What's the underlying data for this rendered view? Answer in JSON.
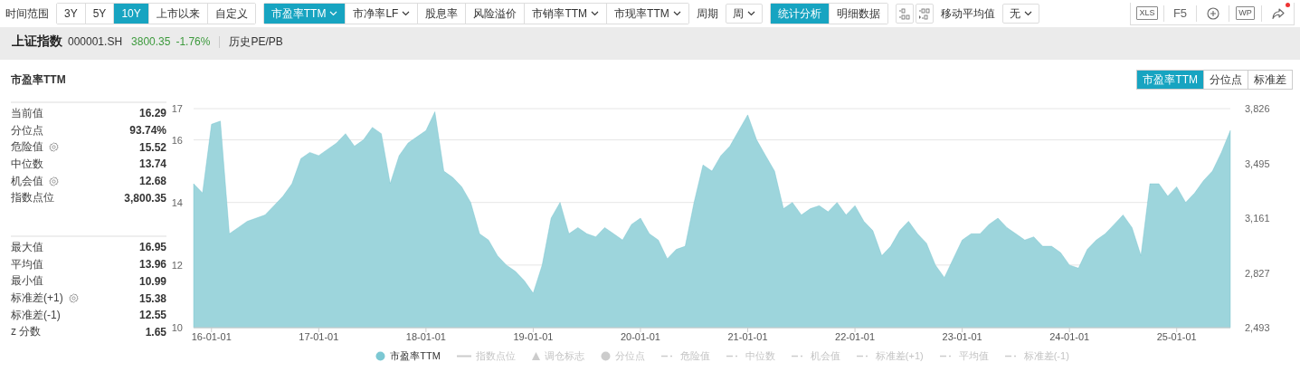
{
  "toolbar": {
    "range_label": "时间范围",
    "ranges": [
      {
        "label": "3Y",
        "selected": false
      },
      {
        "label": "5Y",
        "selected": false
      },
      {
        "label": "10Y",
        "selected": true
      },
      {
        "label": "上市以来",
        "selected": false
      },
      {
        "label": "自定义",
        "selected": false
      }
    ],
    "metrics": [
      {
        "label": "市盈率TTM",
        "dropdown": true,
        "selected": true
      },
      {
        "label": "市净率LF",
        "dropdown": true,
        "selected": false
      },
      {
        "label": "股息率",
        "dropdown": false,
        "selected": false
      },
      {
        "label": "风险溢价",
        "dropdown": false,
        "selected": false
      },
      {
        "label": "市销率TTM",
        "dropdown": true,
        "selected": false
      },
      {
        "label": "市现率TTM",
        "dropdown": true,
        "selected": false
      }
    ],
    "period_label": "周期",
    "period_value": "周",
    "views": [
      {
        "label": "统计分析",
        "selected": true
      },
      {
        "label": "明细数据",
        "selected": false
      }
    ],
    "ma_label": "移动平均值",
    "ma_value": "无",
    "tools": [
      {
        "kind": "file",
        "label": "XLS",
        "badge": false
      },
      {
        "kind": "text",
        "label": "F5",
        "badge": false
      },
      {
        "kind": "plus",
        "badge": false
      },
      {
        "kind": "file",
        "label": "WP",
        "badge": false
      },
      {
        "kind": "share",
        "badge": true
      }
    ]
  },
  "header": {
    "name": "上证指数",
    "code": "000001.SH",
    "price": "3800.35",
    "change": "-1.76%",
    "down": true,
    "subtitle": "历史PE/PB"
  },
  "card": {
    "title": "市盈率TTM",
    "tabs": [
      {
        "label": "市盈率TTM",
        "selected": true
      },
      {
        "label": "分位点",
        "selected": false
      },
      {
        "label": "标准差",
        "selected": false
      }
    ],
    "stats_groups": [
      [
        {
          "label": "当前值",
          "value": "16.29",
          "settings": false
        },
        {
          "label": "分位点",
          "value": "93.74%",
          "settings": false
        },
        {
          "label": "危险值",
          "value": "15.52",
          "settings": true
        },
        {
          "label": "中位数",
          "value": "13.74",
          "settings": false
        },
        {
          "label": "机会值",
          "value": "12.68",
          "settings": true
        },
        {
          "label": "指数点位",
          "value": "3,800.35",
          "settings": false
        }
      ],
      [
        {
          "label": "最大值",
          "value": "16.95",
          "settings": false
        },
        {
          "label": "平均值",
          "value": "13.96",
          "settings": false
        },
        {
          "label": "最小值",
          "value": "10.99",
          "settings": false
        },
        {
          "label": "标准差(+1)",
          "value": "15.38",
          "settings": true
        },
        {
          "label": "标准差(-1)",
          "value": "12.55",
          "settings": false
        },
        {
          "label": "z 分数",
          "value": "1.65",
          "settings": false
        }
      ]
    ],
    "right_axis_labels": [
      "3,826",
      "3,495",
      "3,161",
      "2,827",
      "2,493"
    ],
    "chart_data": {
      "type": "area",
      "grid": true,
      "ylim": [
        10,
        17
      ],
      "yticks": [
        10,
        12,
        14,
        16,
        17
      ],
      "categories": [
        null,
        null,
        "16-01-01",
        null,
        null,
        null,
        null,
        null,
        null,
        null,
        null,
        null,
        null,
        null,
        "17-01-01",
        null,
        null,
        null,
        null,
        null,
        null,
        null,
        null,
        null,
        null,
        null,
        "18-01-01",
        null,
        null,
        null,
        null,
        null,
        null,
        null,
        null,
        null,
        null,
        null,
        "19-01-01",
        null,
        null,
        null,
        null,
        null,
        null,
        null,
        null,
        null,
        null,
        null,
        "20-01-01",
        null,
        null,
        null,
        null,
        null,
        null,
        null,
        null,
        null,
        null,
        null,
        "21-01-01",
        null,
        null,
        null,
        null,
        null,
        null,
        null,
        null,
        null,
        null,
        null,
        "22-01-01",
        null,
        null,
        null,
        null,
        null,
        null,
        null,
        null,
        null,
        null,
        null,
        "23-01-01",
        null,
        null,
        null,
        null,
        null,
        null,
        null,
        null,
        null,
        null,
        null,
        "24-01-01",
        null,
        null,
        null,
        null,
        null,
        null,
        null,
        null,
        null,
        null,
        null,
        "25-01-01",
        null,
        null,
        null,
        null,
        null,
        null
      ],
      "series": [
        {
          "name": "市盈率TTM",
          "color": "#9dd5dc",
          "values": [
            14.6,
            14.3,
            16.5,
            16.6,
            13.0,
            13.2,
            13.4,
            13.5,
            13.6,
            13.9,
            14.2,
            14.6,
            15.4,
            15.6,
            15.5,
            15.7,
            15.9,
            16.2,
            15.8,
            16.0,
            16.4,
            16.2,
            14.6,
            15.5,
            15.9,
            16.1,
            16.3,
            16.9,
            15.0,
            14.8,
            14.5,
            14.0,
            13.0,
            12.8,
            12.3,
            12.0,
            11.8,
            11.5,
            11.1,
            12.0,
            13.5,
            14.0,
            13.0,
            13.2,
            13.0,
            12.9,
            13.2,
            13.0,
            12.8,
            13.3,
            13.5,
            13.0,
            12.8,
            12.2,
            12.5,
            12.6,
            14.0,
            15.2,
            15.0,
            15.5,
            15.8,
            16.3,
            16.8,
            16.0,
            15.5,
            15.0,
            13.8,
            14.0,
            13.6,
            13.8,
            13.9,
            13.7,
            14.0,
            13.6,
            13.9,
            13.4,
            13.1,
            12.3,
            12.6,
            13.1,
            13.4,
            13.0,
            12.7,
            12.0,
            11.6,
            12.2,
            12.8,
            13.0,
            13.0,
            13.3,
            13.5,
            13.2,
            13.0,
            12.8,
            12.9,
            12.6,
            12.6,
            12.4,
            12.0,
            11.9,
            12.5,
            12.8,
            13.0,
            13.3,
            13.6,
            13.2,
            12.3,
            14.6,
            14.6,
            14.2,
            14.5,
            14.0,
            14.3,
            14.7,
            15.0,
            15.6,
            16.3
          ]
        }
      ]
    },
    "legend": [
      {
        "kind": "series",
        "disabled": false
      },
      {
        "kind": "line",
        "label": "指数点位",
        "disabled": true
      },
      {
        "kind": "triangle",
        "label": "调仓标志",
        "disabled": true
      },
      {
        "kind": "dot",
        "label": "分位点",
        "disabled": true
      },
      {
        "kind": "dash",
        "label": "危险值",
        "disabled": true
      },
      {
        "kind": "dash",
        "label": "中位数",
        "disabled": true
      },
      {
        "kind": "dash",
        "label": "机会值",
        "disabled": true
      },
      {
        "kind": "dash",
        "label": "标准差(+1)",
        "disabled": true
      },
      {
        "kind": "dash",
        "label": "平均值",
        "disabled": true
      },
      {
        "kind": "dash",
        "label": "标准差(-1)",
        "disabled": true
      }
    ]
  }
}
